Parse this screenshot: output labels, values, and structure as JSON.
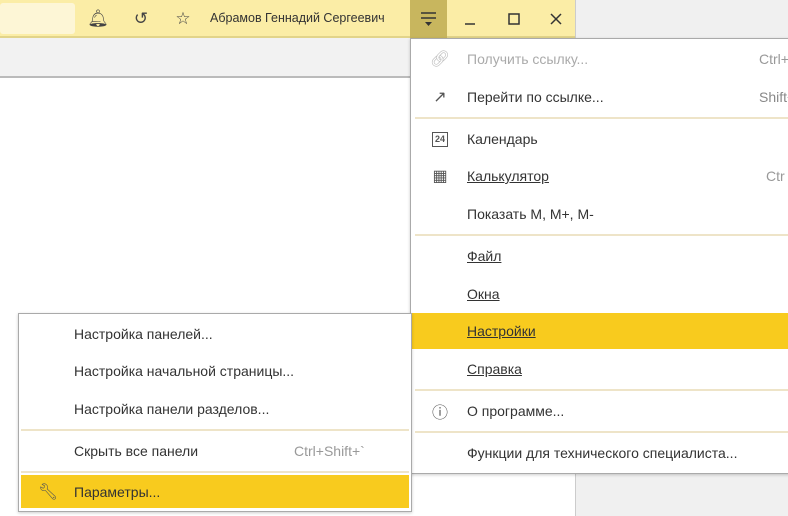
{
  "titlebar": {
    "user_name": "Абрамов Геннадий Сергеевич"
  },
  "main_menu": {
    "items": [
      {
        "label": "Получить ссылку...",
        "shortcut": "Ctrl+",
        "icon": "link-icon",
        "disabled": true
      },
      {
        "label": "Перейти по ссылке...",
        "shortcut": "Shift+",
        "icon": "goto-link-icon"
      },
      {
        "label": "Календарь",
        "icon": "calendar-icon"
      },
      {
        "label": "Калькулятор",
        "shortcut": "Ctr",
        "icon": "calculator-icon"
      },
      {
        "label": "Показать M, M+, M-"
      },
      {
        "label": "Файл"
      },
      {
        "label": "Окна"
      },
      {
        "label": "Настройки",
        "highlighted": true
      },
      {
        "label": "Справка"
      },
      {
        "label": "О программе...",
        "icon": "info-icon"
      },
      {
        "label": "Функции для технического специалиста..."
      }
    ]
  },
  "settings_submenu": {
    "items": [
      {
        "label": "Настройка панелей..."
      },
      {
        "label": "Настройка начальной страницы..."
      },
      {
        "label": "Настройка панели разделов..."
      },
      {
        "label": "Скрыть все панели",
        "shortcut": "Ctrl+Shift+`"
      },
      {
        "label": "Параметры...",
        "icon": "wrench-icon",
        "highlighted": true
      }
    ]
  },
  "colors": {
    "titlebar": "#fbeda6",
    "highlight": "#f8cb1e"
  }
}
